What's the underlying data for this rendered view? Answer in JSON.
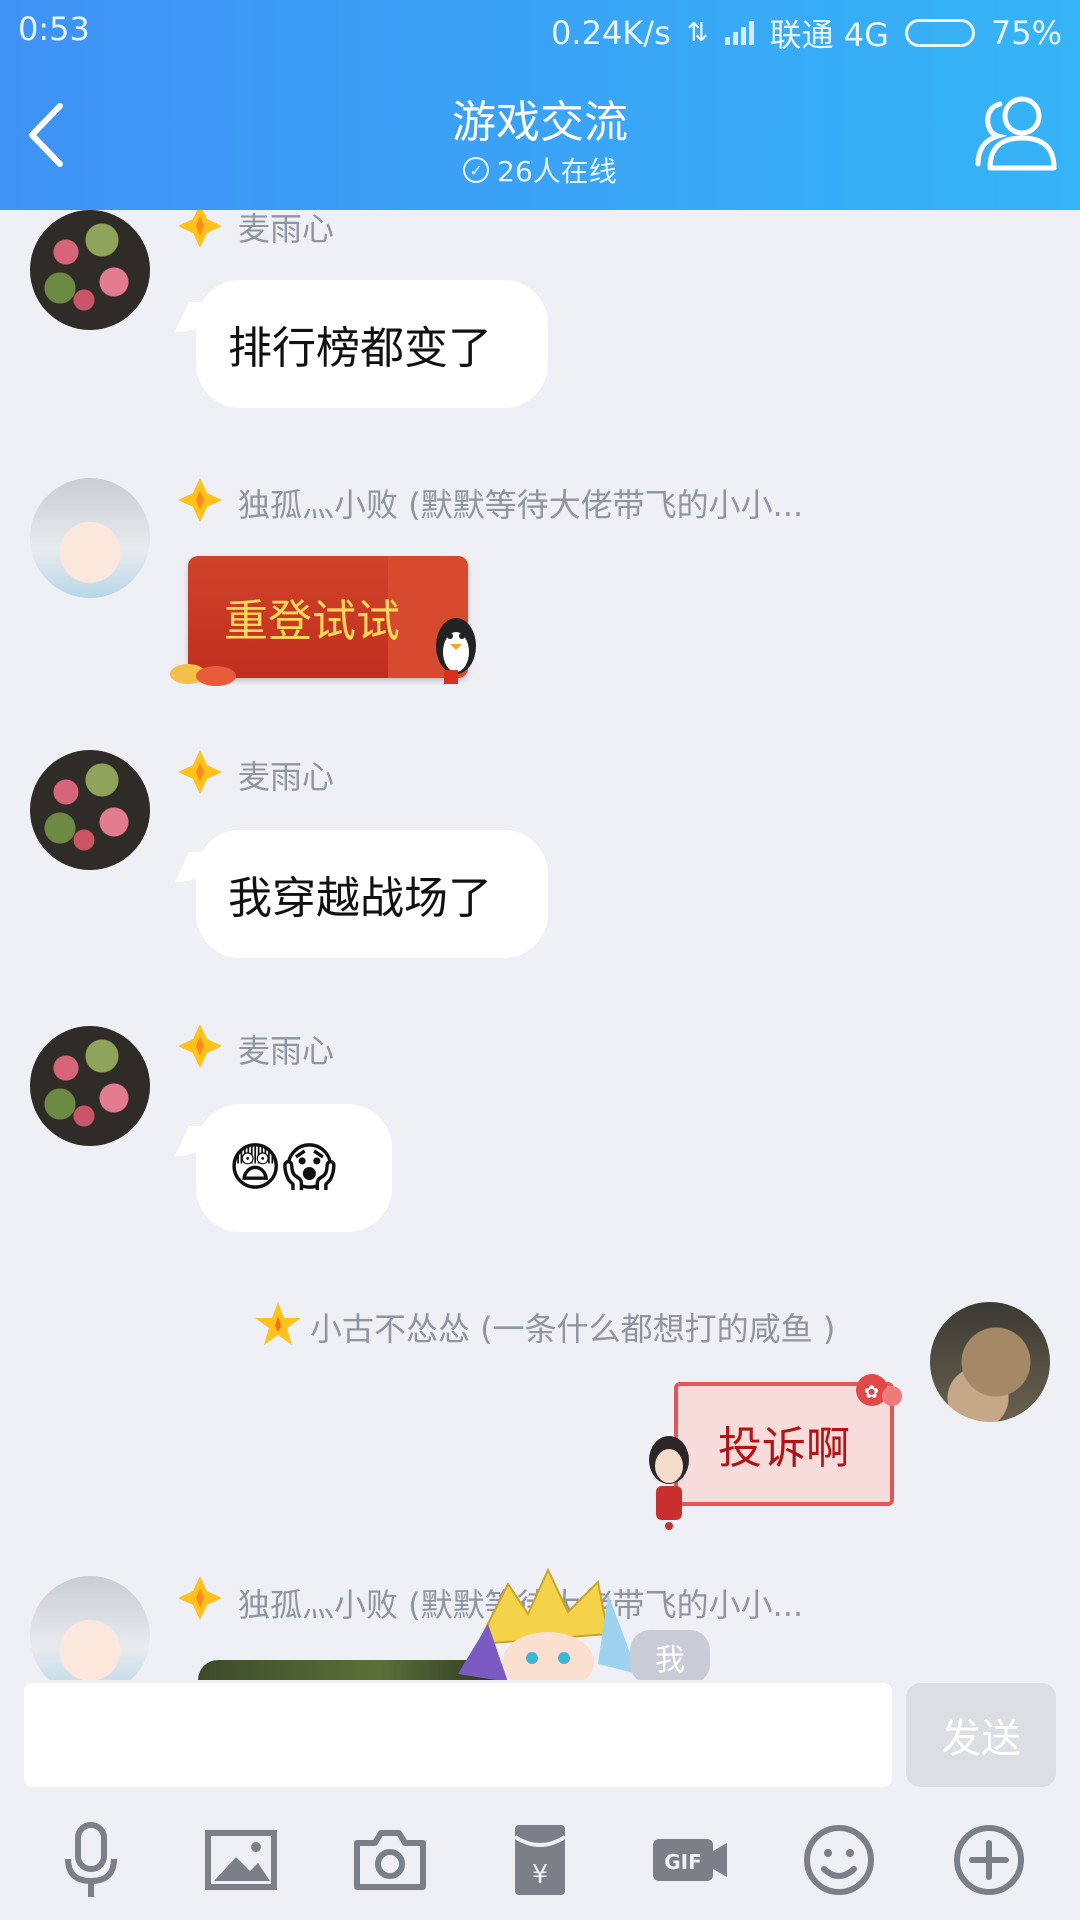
{
  "status_bar": {
    "time": "0:53",
    "speed": "0.24K/s",
    "carrier": "联通 4G",
    "battery": "75%",
    "battery_level": 0.75
  },
  "header": {
    "title": "游戏交流",
    "online": "26人在线"
  },
  "messages": [
    {
      "sender": "麦雨心",
      "text": "排行榜都变了"
    },
    {
      "sender": "独孤灬小败 (默默等待大佬带飞的小小...",
      "sticker_text": "重登试试"
    },
    {
      "sender": "麦雨心",
      "text": "我穿越战场了"
    },
    {
      "sender": "麦雨心",
      "text": "😨😱"
    },
    {
      "sender": "小古不怂怂 (一条什么都想打的咸鱼 )",
      "sticker_text": "投诉啊"
    },
    {
      "sender": "独孤灬小败 (默默等待大佬带飞的小小..."
    }
  ],
  "me_tag": "我",
  "input": {
    "placeholder": "",
    "send_label": "发送"
  },
  "toolbar": [
    "microphone-icon",
    "image-icon",
    "camera-icon",
    "red-packet-icon",
    "gif-icon",
    "emoji-icon",
    "plus-icon"
  ],
  "colors": {
    "header_start": "#3f92f5",
    "header_end": "#35b4f6",
    "background": "#eef0f6"
  }
}
